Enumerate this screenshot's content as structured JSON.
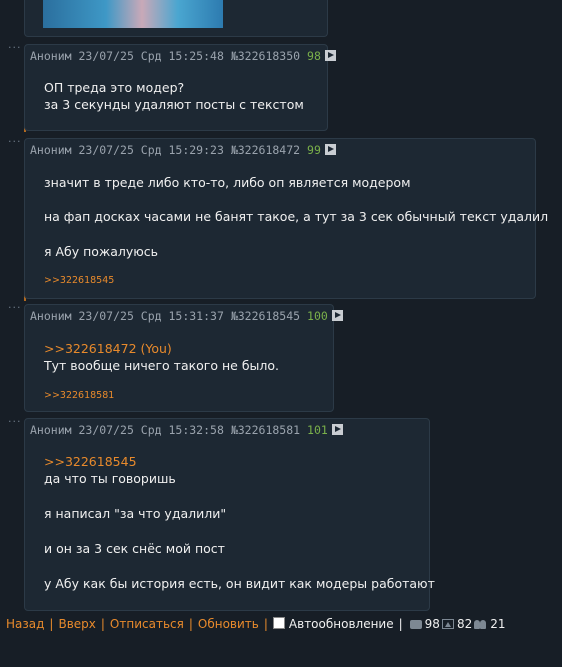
{
  "posts": [
    {
      "author": "Аноним",
      "datetime": "23/07/25 Срд 15:25:48",
      "postno": "№322618350",
      "index": "98",
      "lines": [
        "ОП треда это модер?",
        "за 3 секунды удаляют посты с текстом"
      ]
    },
    {
      "author": "Аноним",
      "datetime": "23/07/25 Срд 15:29:23",
      "postno": "№322618472",
      "index": "99",
      "lines": [
        "значит в треде либо кто-то, либо оп является модером",
        "на фап досках часами не банят такое, а тут за 3 сек обычный текст удалил",
        "я Абу пожалуюсь"
      ],
      "replies": ">>322618545"
    },
    {
      "author": "Аноним",
      "datetime": "23/07/25 Срд 15:31:37",
      "postno": "№322618545",
      "index": "100",
      "quote": ">>322618472 (You)",
      "lines": [
        "Тут вообще ничего такого не было."
      ],
      "replies": ">>322618581"
    },
    {
      "author": "Аноним",
      "datetime": "23/07/25 Срд 15:32:58",
      "postno": "№322618581",
      "index": "101",
      "quote": ">>322618545",
      "lines": [
        "да что ты говоришь",
        "я написал \"за что удалили\"",
        "и он за 3 сек снёс мой пост",
        "у Абу как бы история есть, он видит как модеры работают"
      ]
    }
  ],
  "footer": {
    "back": "Назад",
    "up": "Вверх",
    "unsubscribe": "Отписаться",
    "refresh": "Обновить",
    "autoupdate": "Автообновление",
    "posts_count": "98",
    "images_count": "82",
    "users_count": "21"
  },
  "colors": {
    "background": "#171e26",
    "post_bg": "#1d2833",
    "accent": "#e88a2c",
    "post_index": "#7ab04a"
  }
}
